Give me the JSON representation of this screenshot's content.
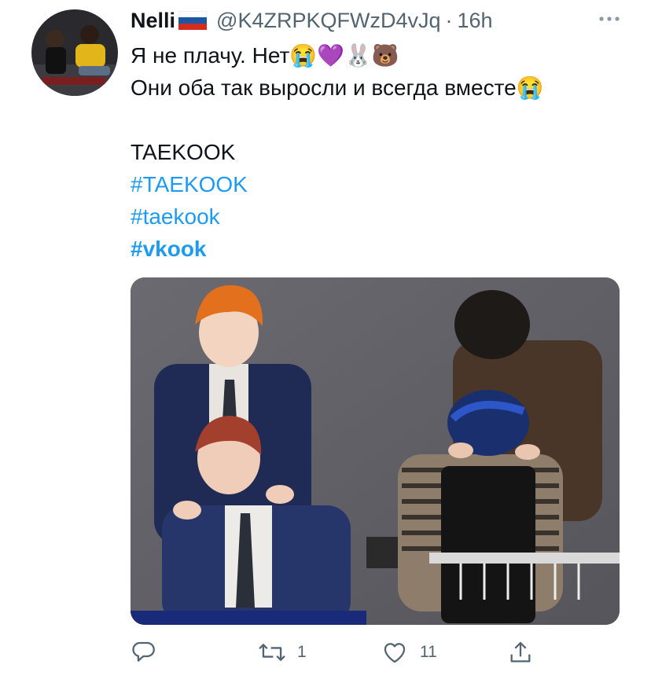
{
  "tweet": {
    "display_name": "Nelli",
    "flag_emoji": "🇷🇺",
    "handle": "@K4ZRPKQFWzD4vJq",
    "separator": "·",
    "time": "16h",
    "text_lines": [
      "Я не плачу. Нет😭💜🐰🐻",
      "Они оба так выросли и всегда вместе😭",
      "",
      "TAEKOOK"
    ],
    "hashtags": [
      "#TAEKOOK",
      "#taekook",
      "#vkook"
    ],
    "media": {
      "kind": "photo"
    }
  },
  "actions": {
    "reply": {
      "icon": "reply-icon",
      "count": ""
    },
    "retweet": {
      "icon": "retweet-icon",
      "count": "1"
    },
    "like": {
      "icon": "heart-icon",
      "count": "11"
    },
    "share": {
      "icon": "share-icon",
      "count": ""
    }
  },
  "colors": {
    "link": "#1d9bf0",
    "secondary_text": "#536471",
    "primary_text": "#0f1419"
  }
}
